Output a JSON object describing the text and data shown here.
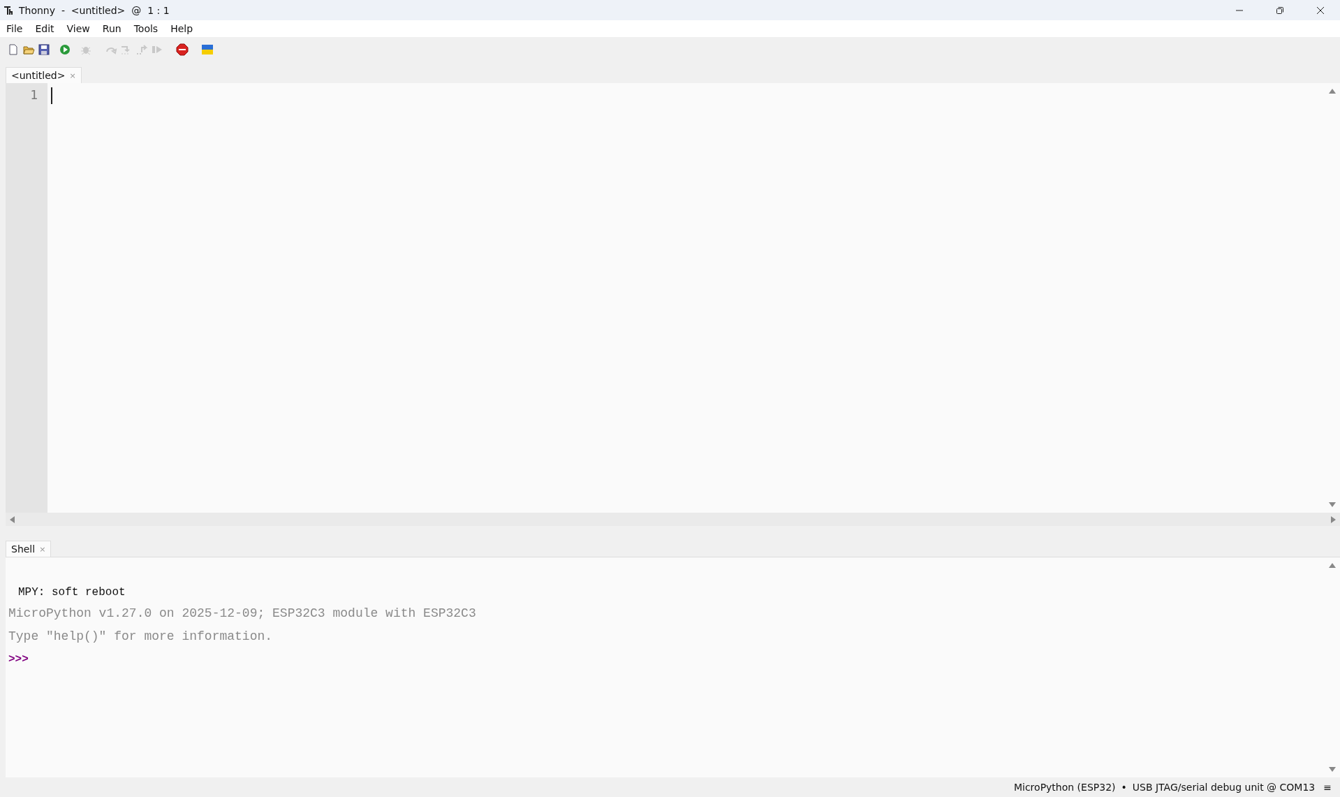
{
  "window": {
    "title": "Thonny  -  <untitled>  @  1 : 1"
  },
  "menu": [
    "File",
    "Edit",
    "View",
    "Run",
    "Tools",
    "Help"
  ],
  "toolbar": [
    {
      "kind": "new",
      "disabled": false
    },
    {
      "kind": "open",
      "disabled": false
    },
    {
      "kind": "save",
      "disabled": false
    },
    {
      "kind": "run",
      "disabled": false
    },
    {
      "kind": "debug",
      "disabled": true
    },
    {
      "kind": "step-over",
      "disabled": true
    },
    {
      "kind": "step-into",
      "disabled": true
    },
    {
      "kind": "step-out",
      "disabled": true
    },
    {
      "kind": "resume",
      "disabled": true
    },
    {
      "kind": "stop",
      "disabled": false
    },
    {
      "kind": "flag",
      "disabled": false
    }
  ],
  "editor": {
    "tab": {
      "label": "<untitled>",
      "close": "×",
      "selected": true
    },
    "line_numbers": [
      "1"
    ]
  },
  "shell": {
    "tab": {
      "label": "Shell",
      "close": "×",
      "selected": true
    },
    "lines": [
      {
        "kind": "output",
        "text": "MPY: soft reboot"
      },
      {
        "kind": "info",
        "text": "MicroPython v1.27.0 on 2025-12-09; ESP32C3 module with ESP32C3"
      },
      {
        "kind": "info",
        "text": "Type \"help()\" for more information."
      },
      {
        "kind": "prompt",
        "text": ">>>"
      }
    ]
  },
  "status_bar": {
    "interpreter": "MicroPython (ESP32)",
    "separator": "•",
    "port": "USB JTAG/serial debug unit @ COM13",
    "menu": "≡"
  }
}
